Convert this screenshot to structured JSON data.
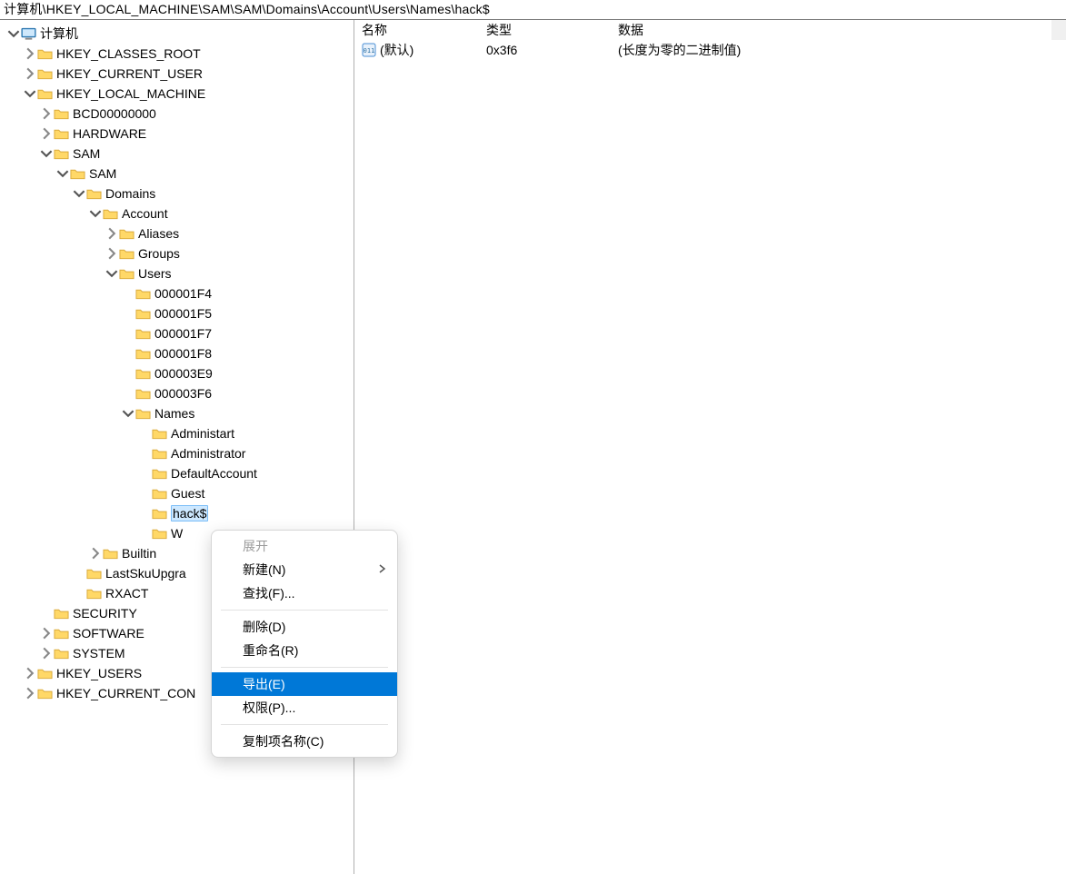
{
  "address_bar": "计算机\\HKEY_LOCAL_MACHINE\\SAM\\SAM\\Domains\\Account\\Users\\Names\\hack$",
  "detail": {
    "headers": {
      "name": "名称",
      "type": "类型",
      "data": "数据"
    },
    "rows": [
      {
        "name": "(默认)",
        "type": "0x3f6",
        "data": "(长度为零的二进制值)"
      }
    ]
  },
  "tree": {
    "root": "计算机",
    "nodes": {
      "hkcr": "HKEY_CLASSES_ROOT",
      "hkcu": "HKEY_CURRENT_USER",
      "hklm": "HKEY_LOCAL_MACHINE",
      "bcd": "BCD00000000",
      "hardware": "HARDWARE",
      "sam": "SAM",
      "sam2": "SAM",
      "domains": "Domains",
      "account": "Account",
      "aliases": "Aliases",
      "groups": "Groups",
      "users": "Users",
      "u1f4": "000001F4",
      "u1f5": "000001F5",
      "u1f7": "000001F7",
      "u1f8": "000001F8",
      "u3e9": "000003E9",
      "u3f6": "000003F6",
      "names": "Names",
      "administart": "Administart",
      "administrator": "Administrator",
      "defaultaccount": "DefaultAccount",
      "guest": "Guest",
      "hack": "hack$",
      "w": "W",
      "builtin": "Builtin",
      "lastsku": "LastSkuUpgra",
      "rxact": "RXACT",
      "security": "SECURITY",
      "software": "SOFTWARE",
      "system": "SYSTEM",
      "hku": "HKEY_USERS",
      "hkcc": "HKEY_CURRENT_CON"
    }
  },
  "context_menu": {
    "expand": "展开",
    "new": "新建(N)",
    "find": "查找(F)...",
    "delete": "删除(D)",
    "rename": "重命名(R)",
    "export": "导出(E)",
    "permissions": "权限(P)...",
    "copy_key_name": "复制项名称(C)"
  }
}
